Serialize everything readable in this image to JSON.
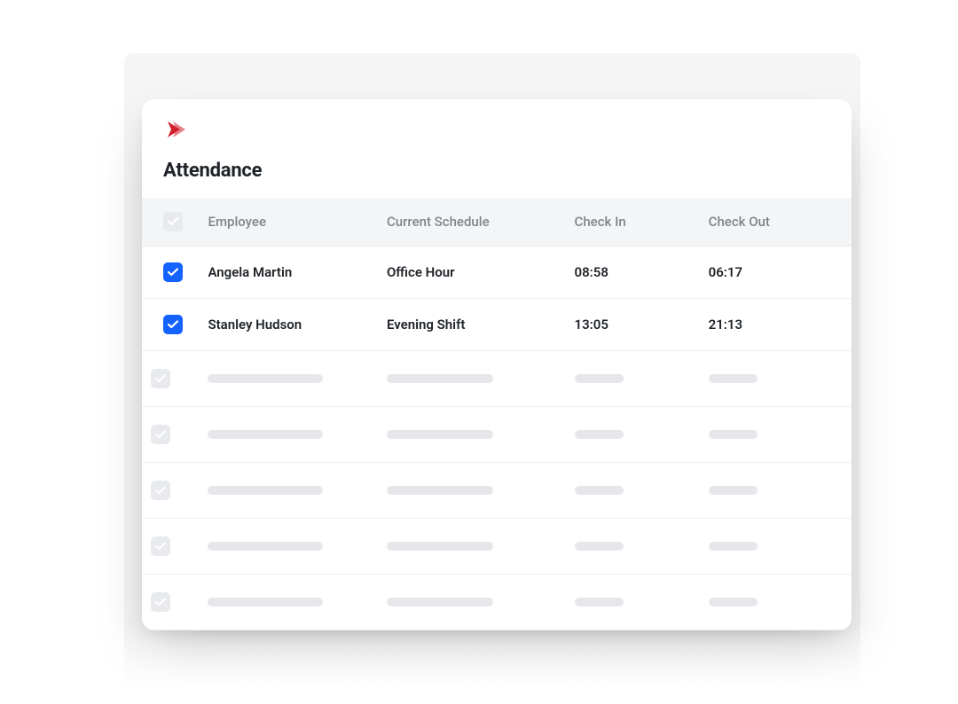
{
  "colors": {
    "brand": "#d41f2b",
    "accent": "#1463ff",
    "muted": "#e5e7ea"
  },
  "page": {
    "title": "Attendance"
  },
  "table": {
    "headers": {
      "employee": "Employee",
      "schedule": "Current Schedule",
      "check_in": "Check In",
      "check_out": "Check Out"
    },
    "rows": [
      {
        "checked": true,
        "employee": "Angela Martin",
        "schedule": "Office Hour",
        "check_in": "08:58",
        "check_out": "06:17"
      },
      {
        "checked": true,
        "employee": "Stanley Hudson",
        "schedule": "Evening Shift",
        "check_in": "13:05",
        "check_out": "21:13"
      }
    ],
    "placeholder_row_count": 5
  }
}
